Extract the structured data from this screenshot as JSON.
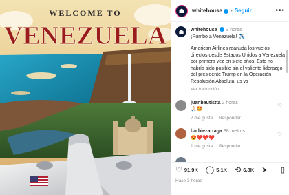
{
  "post": {
    "banner_top": "WELCOME TO",
    "banner_main": "VENEZUELA"
  },
  "header": {
    "username": "whitehouse",
    "follow_label": "Seguir",
    "more_label": "•••"
  },
  "caption": {
    "username": "whitehouse",
    "time": "3 horas",
    "line1": "¡Rumbo a Venezuela! ✈️",
    "text": "American Airlines reanuda los vuelos directos desde Estados Unidos a Venezuela por primera vez en siete años. Esto no habría sido posible sin el valiente liderazgo del presidente Trump en la Operación Resolución Absoluta. us vs",
    "translate": "Ver traducción"
  },
  "comments": [
    {
      "user": "juanbautistta",
      "time": "2 horas",
      "text": "🙏🏻🤩",
      "likes": "2 me gusta",
      "reply": "Responder"
    },
    {
      "user": "barbiezarraga",
      "time": "38 metros",
      "text": "😍❤️❤️❤️",
      "likes": "1 me gusta",
      "reply": "Responder"
    }
  ],
  "actions": {
    "likes": "91.9K",
    "comments": "5.1K",
    "reposts": "6.8K",
    "posted": "Hace 3 horas"
  },
  "colors": {
    "accent": "#0095f6",
    "banner_text": "#9b1c1c"
  }
}
